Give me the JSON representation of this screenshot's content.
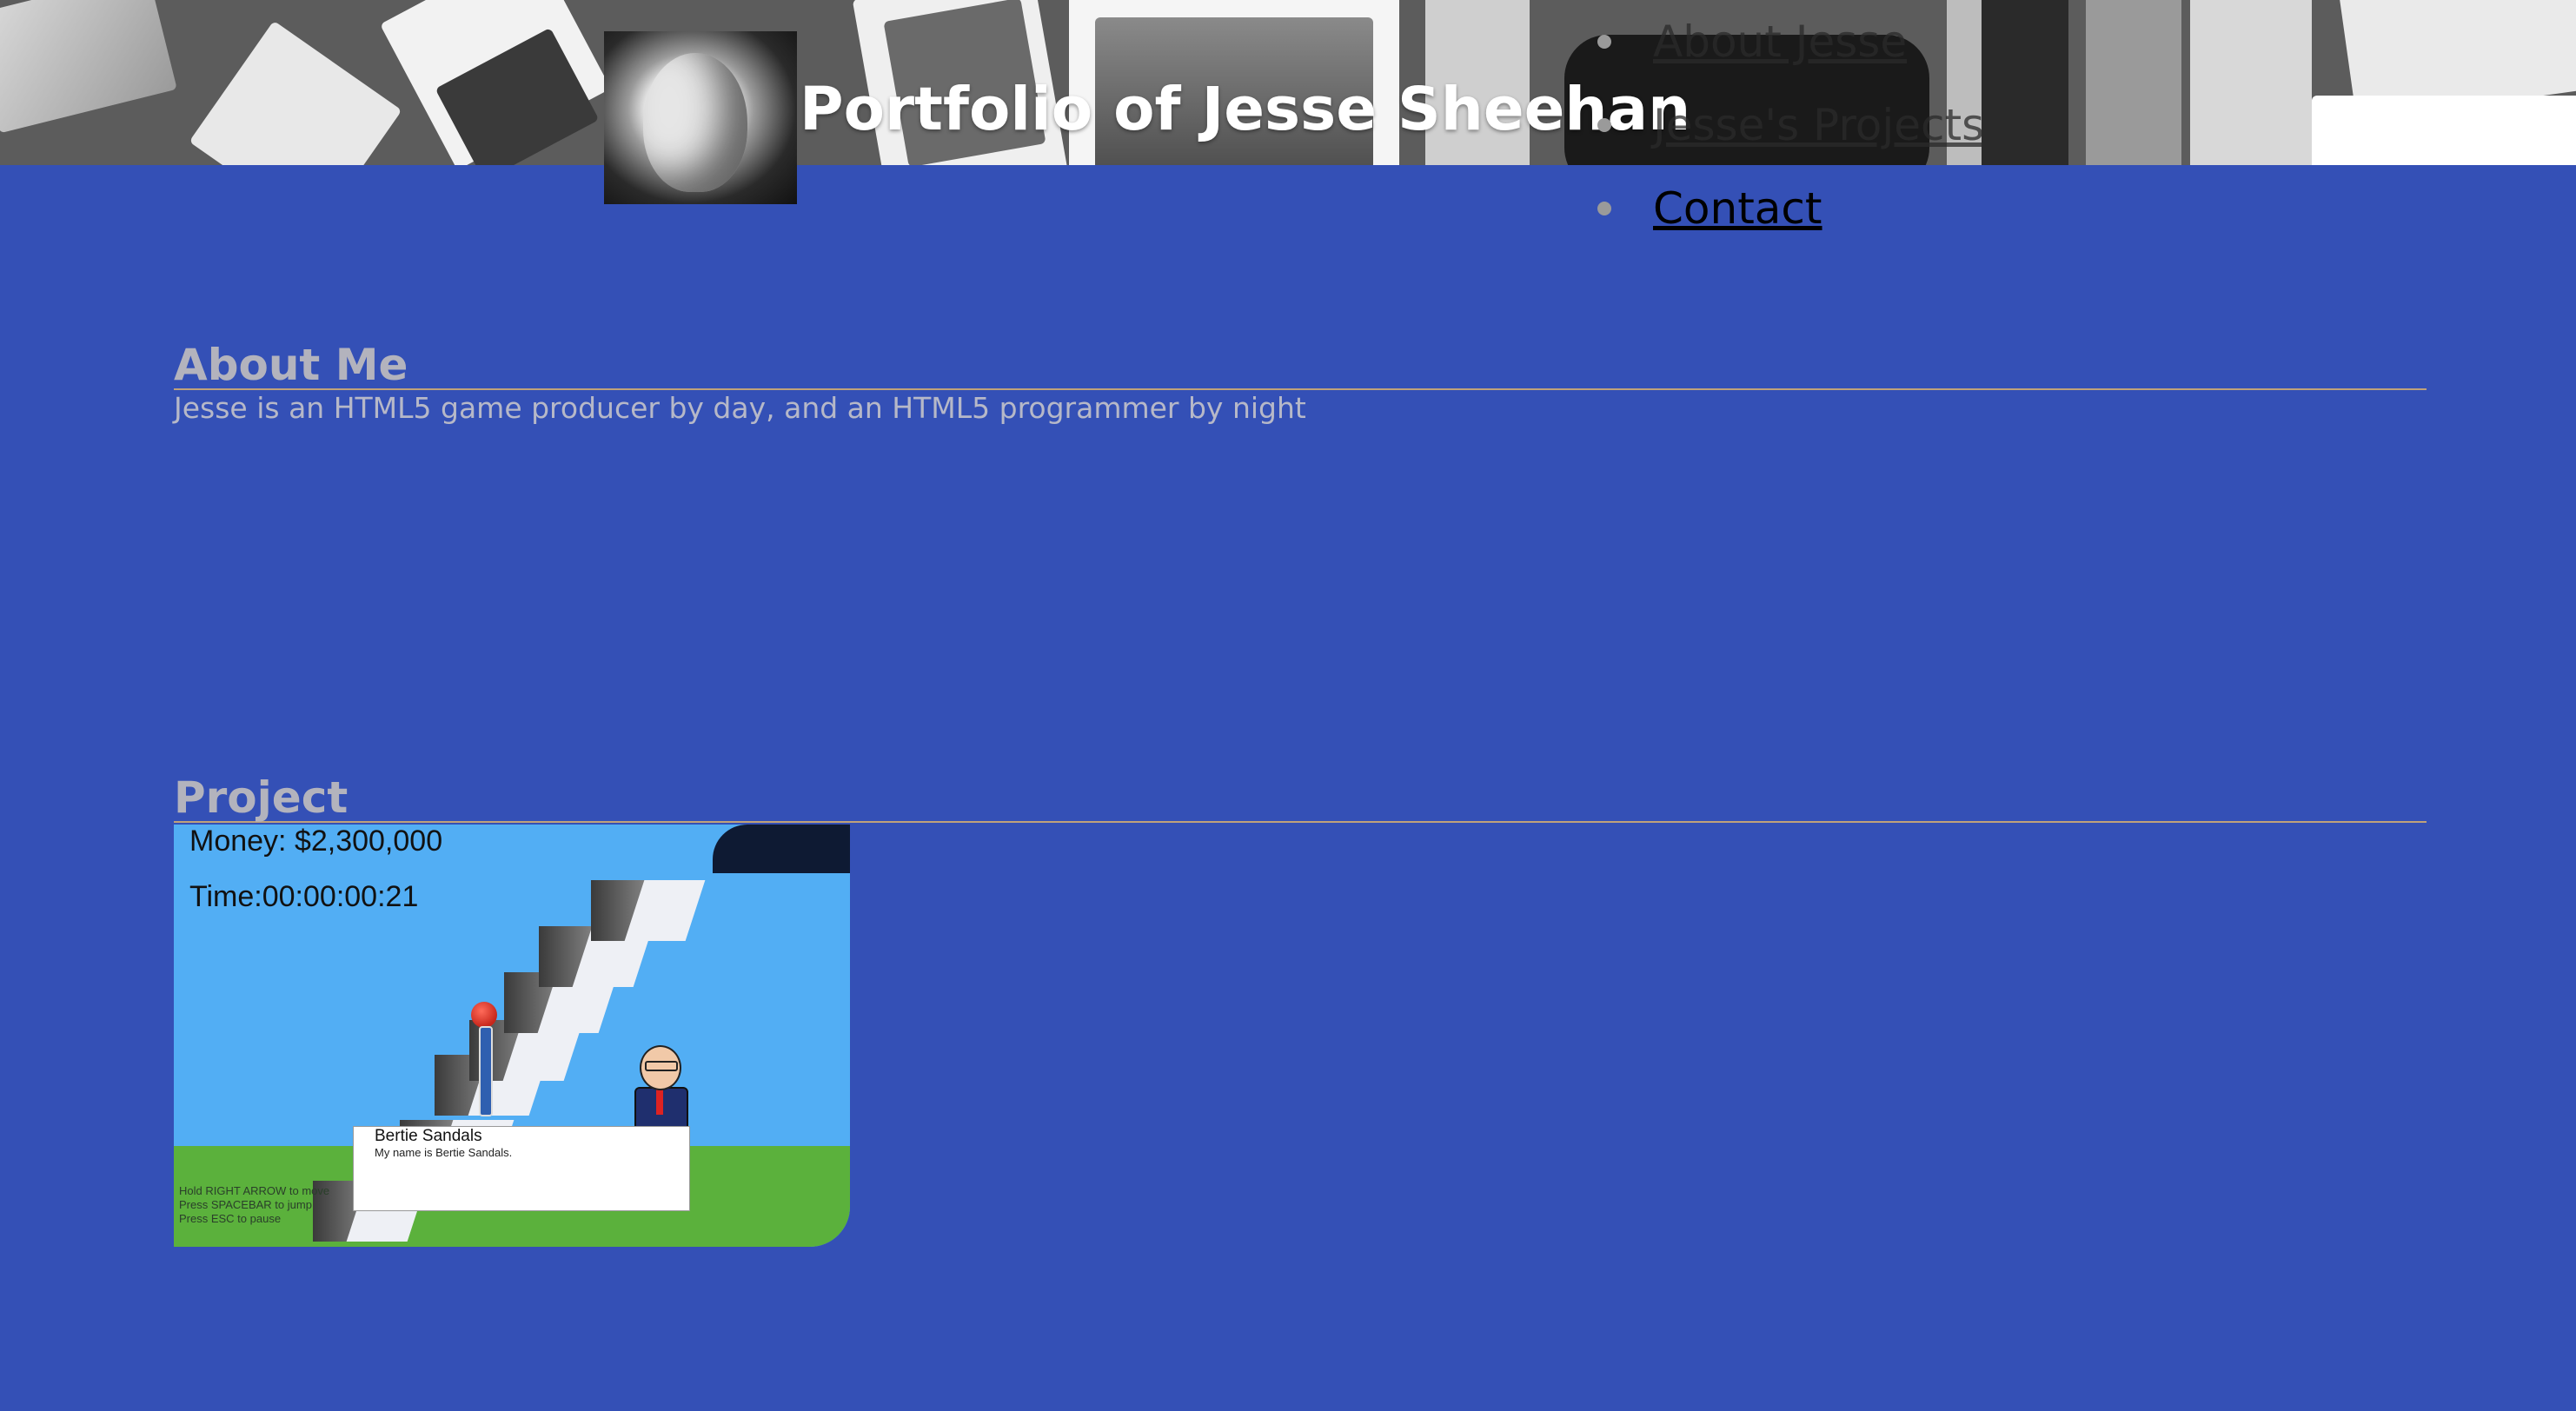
{
  "header": {
    "site_title": "Portfolio of Jesse Sheehan"
  },
  "nav": {
    "items": [
      {
        "label": "About Jesse"
      },
      {
        "label": "Jesse's Projects"
      },
      {
        "label": "Contact"
      }
    ]
  },
  "about": {
    "heading": "About Me",
    "text": "Jesse is an HTML5 game producer by day, and an HTML5 programmer by night"
  },
  "project": {
    "heading": "Project",
    "game": {
      "money_label": "Money: $2,300,000",
      "time_label": "Time:00:00:00:21",
      "dialog_name": "Bertie Sandals",
      "dialog_text": "My name is Bertie Sandals.",
      "instructions": [
        "Hold RIGHT ARROW to move",
        "Press SPACEBAR to jump",
        "Press ESC to pause"
      ]
    }
  },
  "colors": {
    "page_background": "#3450b6",
    "heading_text": "#b3b3bd",
    "rule": "#c0a27a",
    "sky": "#52aef4",
    "grass": "#5bb13c"
  },
  "icons": {
    "nav_bullet": "bullet-icon"
  }
}
